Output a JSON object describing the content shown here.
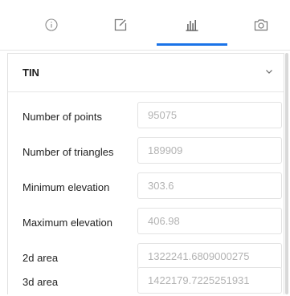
{
  "tabs": [
    {
      "icon": "info-icon",
      "active": false
    },
    {
      "icon": "edit-note-icon",
      "active": false
    },
    {
      "icon": "bar-chart-icon",
      "active": true
    },
    {
      "icon": "camera-icon",
      "active": false
    }
  ],
  "accent_color": "#1a73e8",
  "section": {
    "title": "TIN",
    "expand_icon": "chevron-down-icon"
  },
  "properties": [
    {
      "label": "Number of points",
      "value": "95075"
    },
    {
      "label": "Number of triangles",
      "value": "189909"
    },
    {
      "label": "Minimum elevation",
      "value": "303.6"
    },
    {
      "label": "Maximum elevation",
      "value": "406.98"
    },
    {
      "label": "2d area",
      "value": "1322241.6809000275"
    },
    {
      "label": "3d area",
      "value": "1422179.7225251931"
    }
  ]
}
